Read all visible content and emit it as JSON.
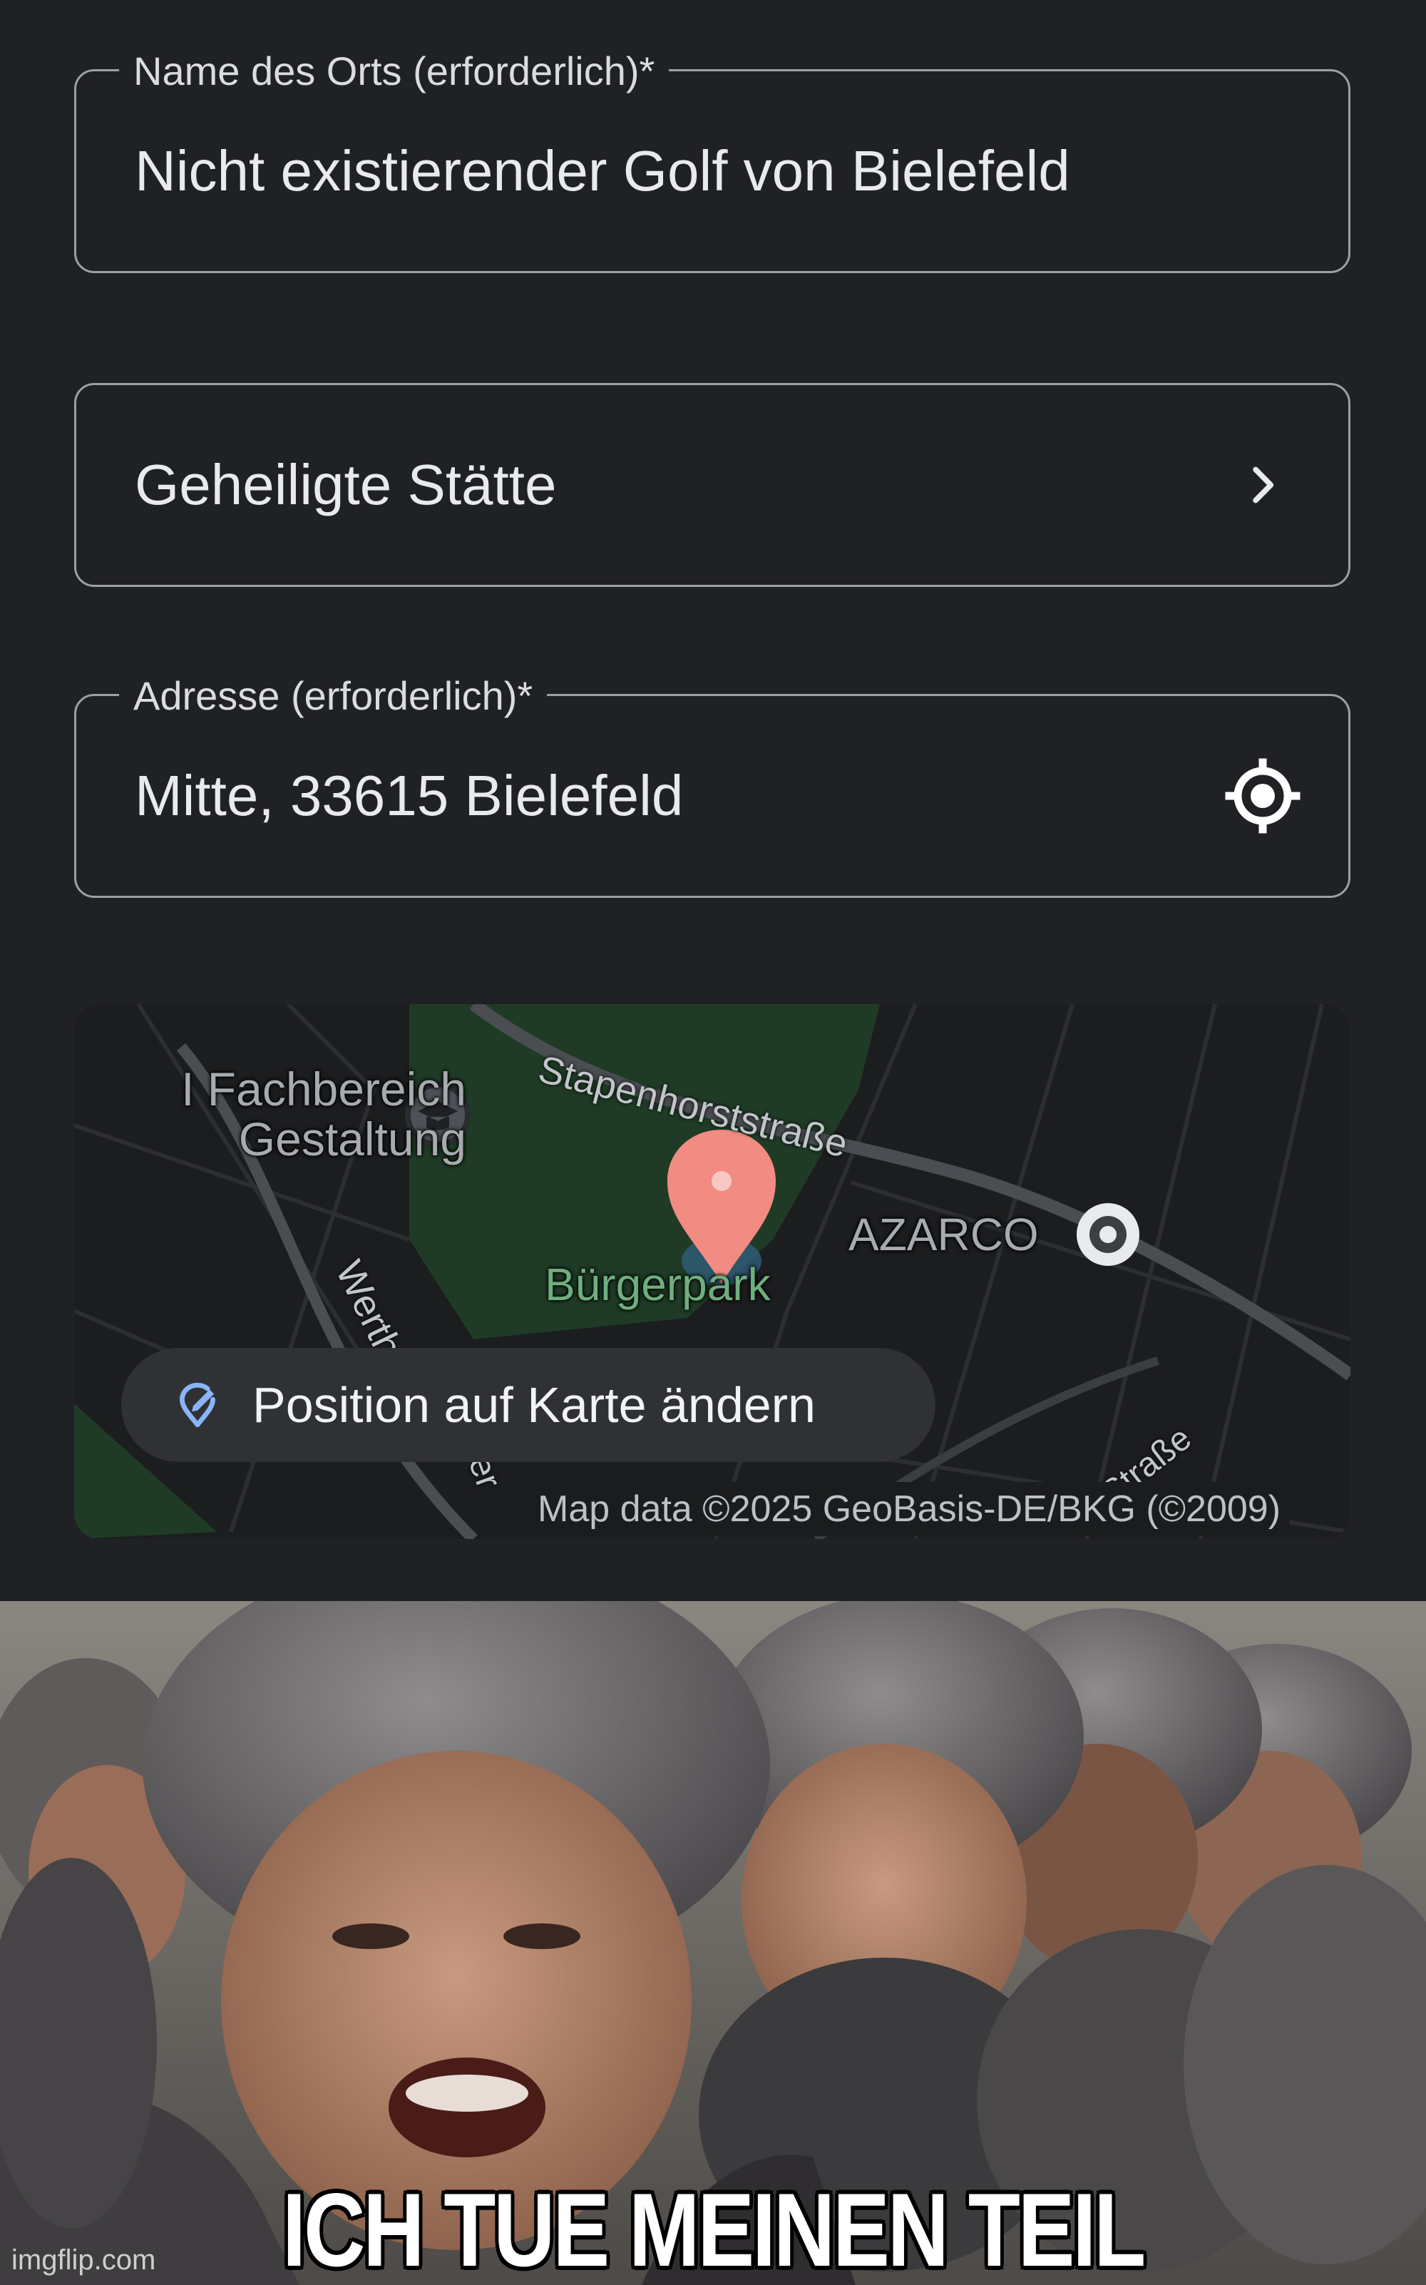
{
  "form": {
    "name_field": {
      "label": "Name des Orts (erforderlich)*",
      "value": "Nicht existierender Golf von Bielefeld"
    },
    "category_field": {
      "value": "Geheiligte Stätte",
      "icon": "chevron-right-icon"
    },
    "address_field": {
      "label": "Adresse (erforderlich)*",
      "value": "Mitte, 33615 Bielefeld",
      "icon": "my-location-icon"
    }
  },
  "map": {
    "labels": {
      "fachbereich": "I Fachbereich\nGestaltung",
      "street_top": "Stapenhorststraße",
      "park": "Bürgerpark",
      "azarco": "AZARCO",
      "street_left": "Werth",
      "street_left2": "er",
      "street_right": "Straße"
    },
    "change_position_button": "Position auf Karte ändern",
    "attribution": "Map data ©2025 GeoBasis-DE/BKG (©2009)",
    "colors": {
      "park": "#1f3d27",
      "pin": "#f28b82",
      "chip": "#303134"
    }
  },
  "meme": {
    "caption": "ICH TUE MEINEN TEIL",
    "watermark": "imgflip.com"
  }
}
